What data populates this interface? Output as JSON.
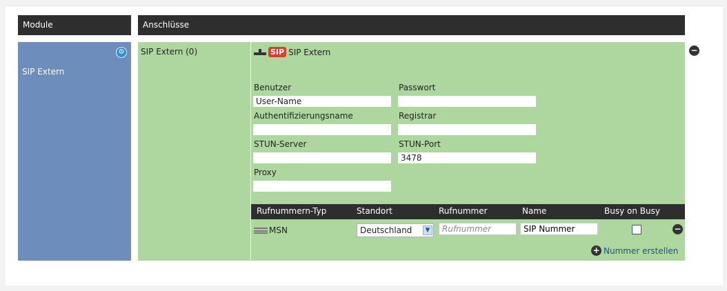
{
  "headers": {
    "modules": "Module",
    "anschluesse": "Anschlüsse"
  },
  "modules": {
    "items": [
      {
        "label": "SIP Extern"
      }
    ]
  },
  "connections": {
    "items": [
      {
        "label": "SIP Extern (0)"
      }
    ]
  },
  "detail": {
    "badge": "SIP",
    "title": "SIP Extern",
    "fields": {
      "benutzer": {
        "label": "Benutzer",
        "value": "User-Name"
      },
      "passwort": {
        "label": "Passwort",
        "value": ""
      },
      "auth": {
        "label": "Authentifizierungsname",
        "value": ""
      },
      "registrar": {
        "label": "Registrar",
        "value": ""
      },
      "stun_server": {
        "label": "STUN-Server",
        "value": ""
      },
      "stun_port": {
        "label": "STUN-Port",
        "value": "3478"
      },
      "proxy": {
        "label": "Proxy",
        "value": ""
      }
    }
  },
  "numbers_table": {
    "columns": [
      "Rufnummern-Typ",
      "Standort",
      "Rufnummer",
      "Name",
      "Busy on Busy"
    ],
    "rows": [
      {
        "type": "MSN",
        "standort": "Deutschland",
        "rufnummer_placeholder": "Rufnummer",
        "name": "SIP Nummer",
        "busy_on_busy": false
      }
    ]
  },
  "add_number_label": "Nummer erstellen",
  "icons": {
    "gear": "gear-icon",
    "plug": "plug-icon",
    "remove": "minus-circle-icon",
    "add": "plus-circle-icon",
    "drag": "drag-handle-icon",
    "dropdown": "chevron-down-icon"
  },
  "colors": {
    "header_bg": "#2e2e2e",
    "module_bg": "#6d8dbd",
    "panel_bg": "#aed7a0",
    "sip_badge": "#d9402b"
  }
}
